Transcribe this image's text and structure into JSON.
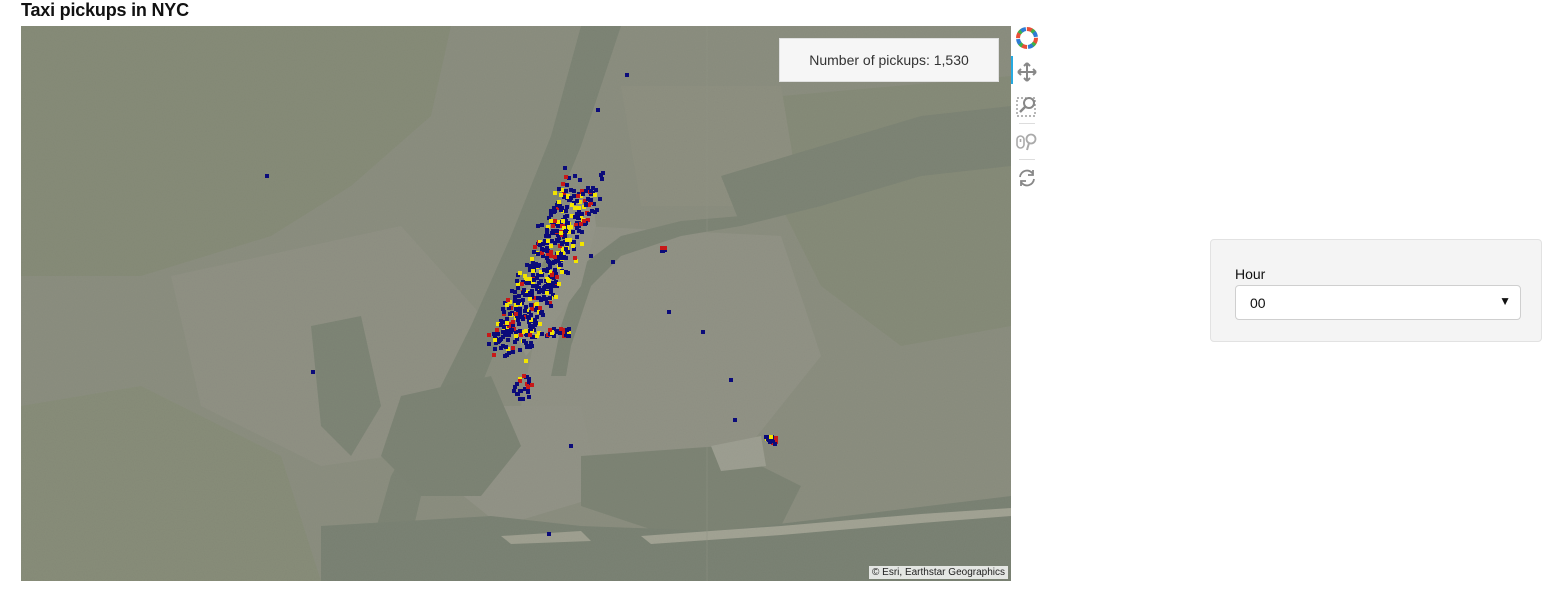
{
  "page": {
    "title": "Taxi pickups in NYC"
  },
  "map": {
    "overlay_text": "Number of pickups: 1,530",
    "attribution": "© Esri, Earthstar Geographics",
    "colors": {
      "water": "#5c6b5a",
      "urban": "#9c9a93",
      "vegetation": "#7f8a6a",
      "low": "#0b0b7a",
      "mid": "#c81818",
      "high": "#f2e400"
    }
  },
  "toolbar": {
    "tools": [
      {
        "name": "bokeh-logo-icon",
        "active": false
      },
      {
        "name": "pan-tool-icon",
        "active": true
      },
      {
        "name": "box-zoom-tool-icon",
        "active": false
      },
      {
        "name": "wheel-zoom-tool-icon",
        "active": false
      },
      {
        "name": "reset-tool-icon",
        "active": false
      }
    ]
  },
  "widget": {
    "label": "Hour",
    "selected": "00"
  }
}
